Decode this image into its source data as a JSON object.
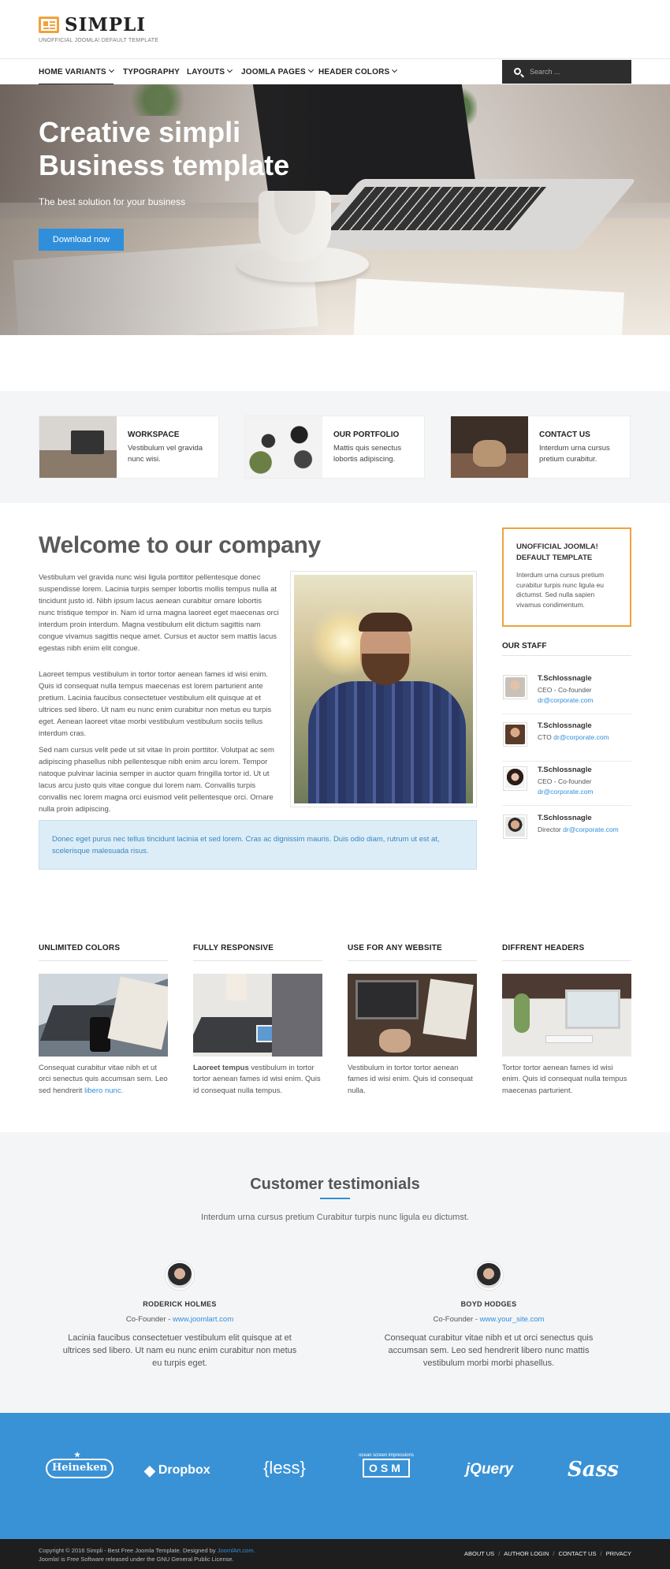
{
  "header": {
    "logo_text": "SIMPLI",
    "tagline": "UNOFFICIAL JOOMLA! DEFAULT TEMPLATE"
  },
  "nav": {
    "items": [
      {
        "label": "HOME VARIANTS",
        "dropdown": true,
        "active": true
      },
      {
        "label": "TYPOGRAPHY",
        "dropdown": false
      },
      {
        "label": "LAYOUTS",
        "dropdown": true
      },
      {
        "label": "JOOMLA PAGES",
        "dropdown": true
      },
      {
        "label": "HEADER COLORS",
        "dropdown": true
      }
    ],
    "search_placeholder": "Search ..."
  },
  "hero": {
    "title": "Creative simpli Business template",
    "subtitle": "The best solution for your business",
    "button": "Download now"
  },
  "features": [
    {
      "title": "WORKSPACE",
      "text": "Vestibulum vel gravida nunc wisi."
    },
    {
      "title": "OUR PORTFOLIO",
      "text": "Mattis quis senectus lobortis adipiscing."
    },
    {
      "title": "CONTACT US",
      "text": "Interdum urna cursus pretium curabitur."
    }
  ],
  "main": {
    "heading": "Welcome to our company",
    "paragraphs": [
      "Vestibulum vel gravida nunc wisi ligula porttitor pellentesque donec suspendisse lorem. Lacinia turpis semper lobortis mollis tempus nulla at tincidunt justo id. Nibh ipsum lacus aenean curabitur ornare lobortis nunc tristique tempor in. Nam id urna magna laoreet eget maecenas orci interdum proin interdum. Magna vestibulum elit dictum sagittis nam congue vivamus sagittis neque amet. Cursus et auctor sem mattis lacus egestas nibh enim elit congue.",
      "Laoreet tempus vestibulum in tortor tortor aenean fames id wisi enim. Quis id consequat nulla tempus maecenas est lorem parturient ante pretium. Lacinia faucibus consectetuer vestibulum elit quisque at et ultrices sed libero. Ut nam eu nunc enim curabitur non metus eu turpis eget. Aenean laoreet vitae morbi vestibulum vestibulum sociis tellus interdum cras.",
      "Sed nam cursus velit pede ut sit vitae In proin porttitor. Volutpat ac sem adipiscing phasellus nibh pellentesque nibh enim arcu lorem. Tempor natoque pulvinar lacinia semper in auctor quam fringilla tortor id. Ut ut lacus arcu justo quis vitae congue dui lorem nam. Convallis turpis convallis nec lorem magna orci euismod velit pellentesque orci. Ornare nulla proin adipiscing."
    ],
    "callout": "Donec eget purus nec tellus tincidunt lacinia et sed lorem. Cras ac dignissim mauris. Duis odio diam, rutrum ut est at, scelerisque malesuada risus."
  },
  "sidebar": {
    "box_title": "UNOFFICIAL JOOMLA! DEFAULT TEMPLATE",
    "box_text": "Interdum urna cursus pretium curabitur turpis nunc ligula eu dictumst. Sed nulla sapien vivamus condimentum.",
    "staff_heading": "OUR STAFF",
    "staff": [
      {
        "name": "T.Schlossnagle",
        "role": "CEO - Co-founder",
        "email": "dr@corporate.com",
        "inline": false
      },
      {
        "name": "T.Schlossnagle",
        "role": "CTO",
        "email": "dr@corporate.com",
        "inline": true
      },
      {
        "name": "T.Schlossnagle",
        "role": "CEO - Co-founder",
        "email": "dr@corporate.com",
        "inline": false
      },
      {
        "name": "T.Schlossnagle",
        "role": "Director",
        "email": "dr@corporate.com",
        "inline": true
      }
    ]
  },
  "columns": [
    {
      "title": "UNLIMITED COLORS",
      "text": "Consequat curabitur vitae nibh et ut orci senectus quis accumsan sem. Leo sed hendrerit ",
      "link": "libero nunc."
    },
    {
      "title": "FULLY RESPONSIVE",
      "bold": "Laoreet tempus",
      "text": " vestibulum in tortor tortor aenean fames id wisi enim. Quis id consequat nulla tempus."
    },
    {
      "title": "USE FOR ANY WEBSITE",
      "text": "Vestibulum in tortor tortor aenean fames id wisi enim. Quis id consequat nulla."
    },
    {
      "title": "DIFFRENT HEADERS",
      "text": "Tortor tortor aenean fames id wisi enim. Quis id consequat nulla tempus maecenas parturient."
    }
  ],
  "testimonials": {
    "heading": "Customer testimonials",
    "subtitle": "Interdum urna cursus pretium Curabitur turpis nunc ligula eu dictumst.",
    "people": [
      {
        "name": "RODERICK HOLMES",
        "role": "Co-Founder - ",
        "link": "www.joomlart.com",
        "quote": "Lacinia faucibus consectetuer vestibulum elit quisque at et ultrices sed libero. Ut nam eu nunc enim curabitur non metus eu turpis eget."
      },
      {
        "name": "BOYD HODGES",
        "role": "Co-Founder - ",
        "link": "www.your_site.com",
        "quote": "Consequat curabitur vitae nibh et ut orci senectus quis accumsan sem. Leo sed hendrerit libero nunc mattis vestibulum morbi morbi phasellus."
      }
    ]
  },
  "brands": {
    "items": [
      "Heineken",
      "Dropbox",
      "{less}",
      "OSM",
      "jQuery",
      "Sass"
    ],
    "osm_caption": "ocean screen impressions"
  },
  "footer": {
    "copyright": "Copyright © 2016 Simpli - Best Free Joomla Template. Designed by ",
    "designer_link": "JoomlArt.com.",
    "license": "Joomla! is Free Software released under the GNU General Public License.",
    "links": [
      "ABOUT US",
      "AUTHOR LOGIN",
      "CONTACT US",
      "PRIVACY"
    ]
  },
  "colors": {
    "accent": "#2f8fdb",
    "brand_orange": "#f0a23b",
    "brands_bg": "#3a92d6",
    "footer_bg": "#1e1e1e"
  }
}
